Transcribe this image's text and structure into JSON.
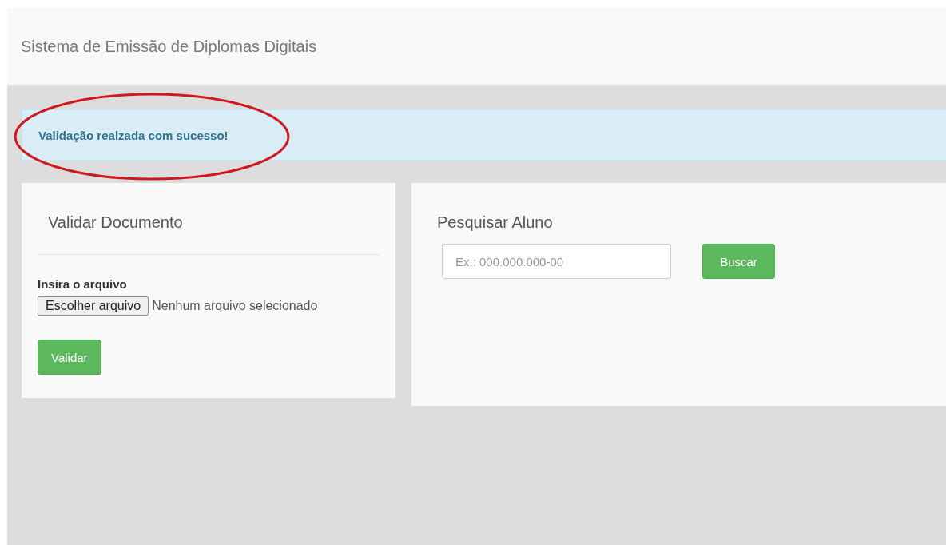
{
  "header": {
    "title": "Sistema de Emissão de Diplomas Digitais"
  },
  "alert": {
    "message": "Validação realzada com sucesso!"
  },
  "validate_panel": {
    "title": "Validar Documento",
    "file_label": "Insira o arquivo",
    "file_button": "Escolher arquivo",
    "file_status": "Nenhum arquivo selecionado",
    "submit": "Validar"
  },
  "search_panel": {
    "title": "Pesquisar Aluno",
    "placeholder": "Ex.: 000.000.000-00",
    "submit": "Buscar"
  }
}
